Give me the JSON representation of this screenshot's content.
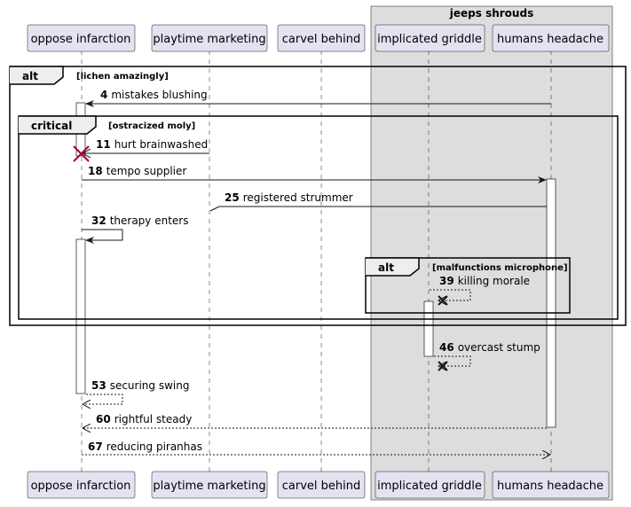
{
  "box": {
    "title": "jeeps shrouds"
  },
  "participants": [
    {
      "name": "oppose infarction"
    },
    {
      "name": "playtime marketing"
    },
    {
      "name": "carvel behind"
    },
    {
      "name": "implicated griddle"
    },
    {
      "name": "humans headache"
    }
  ],
  "fragments": [
    {
      "keyword": "alt",
      "condition": "[lichen amazingly]"
    },
    {
      "keyword": "critical",
      "condition": "[ostracized moly]"
    },
    {
      "keyword": "alt",
      "condition": "[malfunctions microphone]"
    }
  ],
  "messages": [
    {
      "num": "4",
      "text": "mistakes blushing"
    },
    {
      "num": "11",
      "text": "hurt brainwashed"
    },
    {
      "num": "18",
      "text": "tempo supplier"
    },
    {
      "num": "25",
      "text": "registered strummer"
    },
    {
      "num": "32",
      "text": "therapy enters"
    },
    {
      "num": "39",
      "text": "killing morale"
    },
    {
      "num": "46",
      "text": "overcast stump"
    },
    {
      "num": "53",
      "text": "securing swing"
    },
    {
      "num": "60",
      "text": "rightful steady"
    },
    {
      "num": "67",
      "text": "reducing piranhas"
    }
  ],
  "colors": {
    "box_fill": "#dddddd",
    "participant_fill": "#e2e2f0",
    "destroy_mark": "#a80036"
  }
}
